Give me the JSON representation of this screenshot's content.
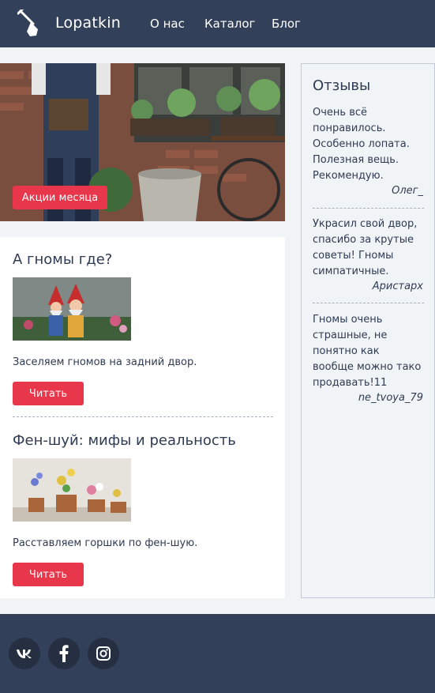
{
  "header": {
    "logo_text": "Lopatkin",
    "nav": [
      "О нас",
      "Каталог",
      "Блог"
    ]
  },
  "hero": {
    "promo_label": "Акции месяца"
  },
  "articles": [
    {
      "title": "А гномы где?",
      "text": "Заселяем гномов на задний двор.",
      "button": "Читать"
    },
    {
      "title": "Фен-шуй: мифы и реальность",
      "text": "Расставляем горшки по фен-шую.",
      "button": "Читать"
    }
  ],
  "reviews": {
    "title": "Отзывы",
    "items": [
      {
        "lines": [
          "Очень всё",
          "понравилось.",
          "Особенно лопата.",
          "Полезная вещь.",
          "Рекомендую."
        ],
        "author": "Олег_"
      },
      {
        "lines": [
          "Украсил свой двор,",
          "спасибо за крутые",
          "советы! Гномы",
          "симпатичные."
        ],
        "author": "Аристарх"
      },
      {
        "lines": [
          "Гномы очень",
          "страшные, не",
          "понятно как",
          "вообще можно тако",
          "продавать!11"
        ],
        "author": "ne_tvoya_79"
      }
    ]
  },
  "footer": {
    "social": [
      "vk-icon",
      "facebook-icon",
      "instagram-icon"
    ]
  },
  "colors": {
    "header_bg": "#33405a",
    "accent": "#e8364a",
    "page_bg": "#f1f4f7"
  }
}
